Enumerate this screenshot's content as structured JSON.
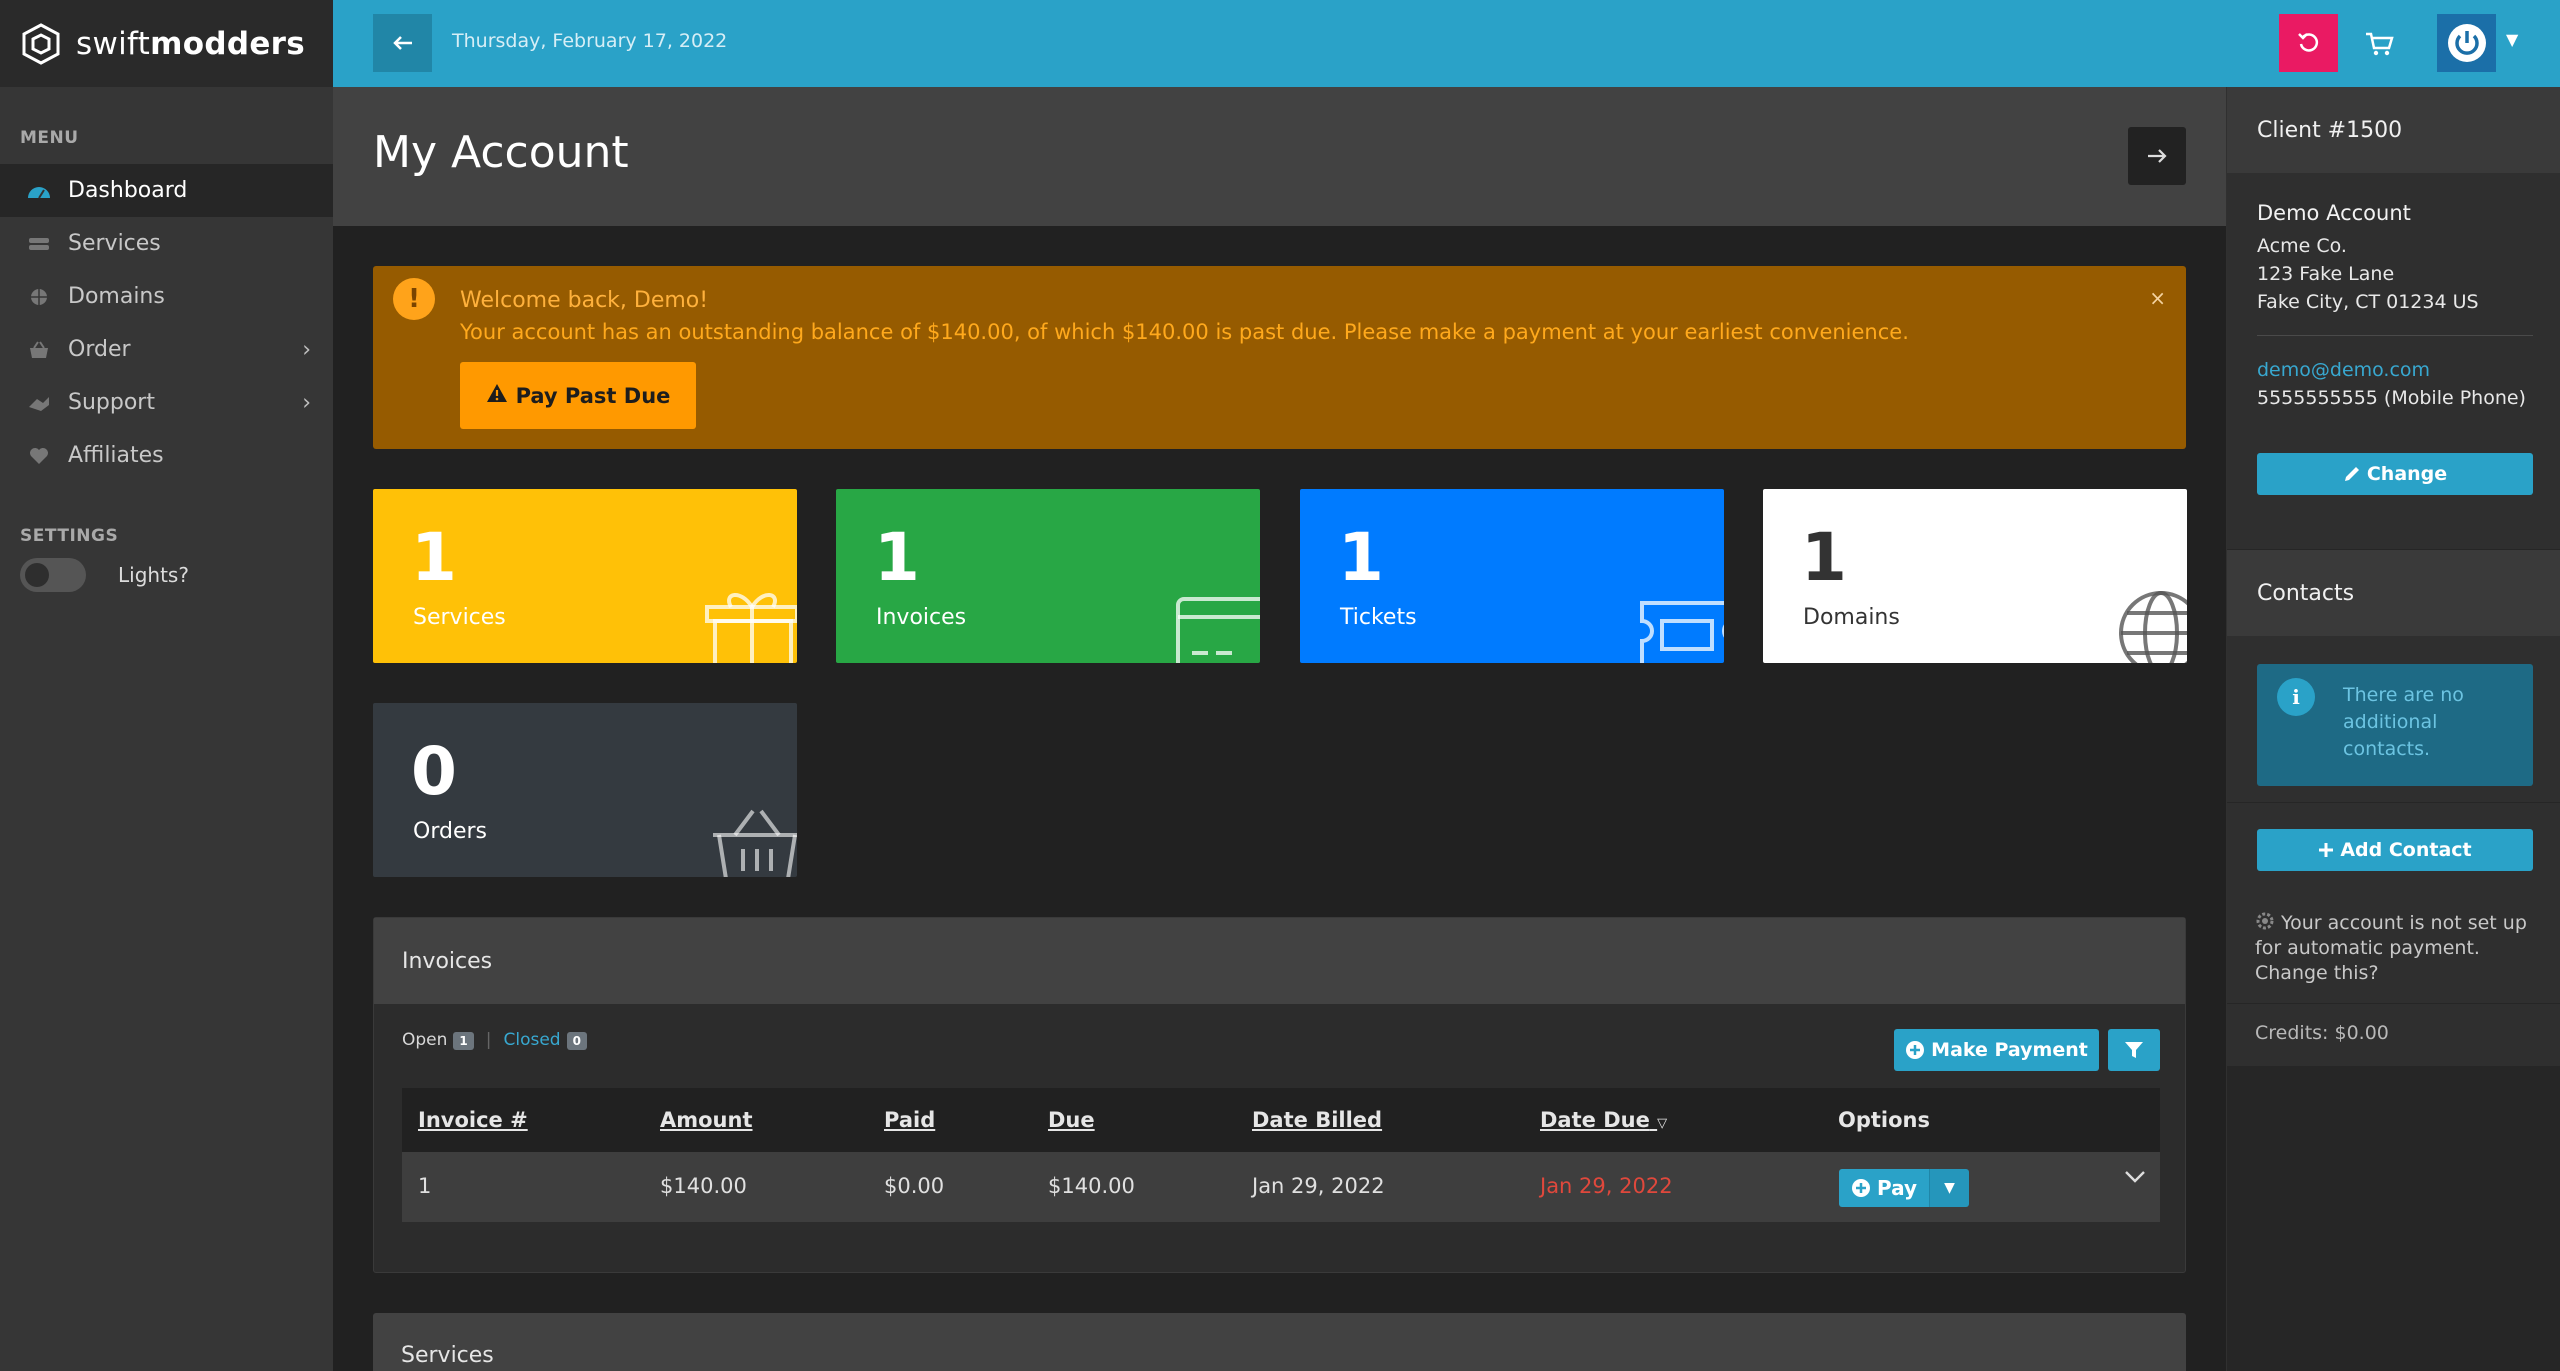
{
  "brand": {
    "name_light": "swift",
    "name_bold": "modders"
  },
  "sidebar": {
    "menu_label": "MENU",
    "items": [
      {
        "label": "Dashboard",
        "icon": "dashboard-icon",
        "active": true
      },
      {
        "label": "Services",
        "icon": "services-icon"
      },
      {
        "label": "Domains",
        "icon": "globe-icon"
      },
      {
        "label": "Order",
        "icon": "basket-icon",
        "has_children": true
      },
      {
        "label": "Support",
        "icon": "support-icon",
        "has_children": true
      },
      {
        "label": "Affiliates",
        "icon": "heart-icon"
      }
    ],
    "settings_label": "SETTINGS",
    "lights_label": "Lights?"
  },
  "topbar": {
    "date": "Thursday, February 17, 2022"
  },
  "page": {
    "title": "My Account"
  },
  "alert": {
    "title": "Welcome back, Demo!",
    "message": "Your account has an outstanding balance of $140.00, of which $140.00 is past due. Please make a payment at your earliest convenience.",
    "button": "Pay Past Due",
    "close": "×"
  },
  "stats": {
    "services": {
      "count": "1",
      "label": "Services"
    },
    "invoices": {
      "count": "1",
      "label": "Invoices"
    },
    "tickets": {
      "count": "1",
      "label": "Tickets"
    },
    "domains": {
      "count": "1",
      "label": "Domains"
    },
    "orders": {
      "count": "0",
      "label": "Orders"
    }
  },
  "invoices": {
    "title": "Invoices",
    "tab_open": "Open",
    "tab_open_count": "1",
    "tab_closed": "Closed",
    "tab_closed_count": "0",
    "make_payment": "Make Payment",
    "columns": [
      "Invoice #",
      "Amount",
      "Paid",
      "Due",
      "Date Billed",
      "Date Due",
      "Options"
    ],
    "rows": [
      {
        "invoice": "1",
        "amount": "$140.00",
        "paid": "$0.00",
        "due": "$140.00",
        "billed": "Jan 29, 2022",
        "date_due": "Jan 29, 2022",
        "action": "Pay"
      }
    ]
  },
  "services_panel": {
    "title": "Services"
  },
  "right": {
    "client": "Client #1500",
    "account_name": "Demo Account",
    "company": "Acme Co.",
    "address1": "123 Fake Lane",
    "address2": "Fake City, CT 01234 US",
    "email": "demo@demo.com",
    "phone": "5555555555 (Mobile Phone)",
    "change": "Change",
    "contacts_title": "Contacts",
    "no_contacts": "There are no additional contacts.",
    "add_contact": "Add Contact",
    "autopay": "Your account is not set up for automatic payment. Change this?",
    "credits": "Credits: $0.00"
  },
  "colors": {
    "topbar": "#2aa2c8",
    "alert_bg": "#965b00",
    "services_card": "#ffc107",
    "invoices_card": "#28a745",
    "tickets_card": "#007bff",
    "domains_card": "#ffffff",
    "orders_card": "#343a40",
    "danger": "#e0483c"
  }
}
